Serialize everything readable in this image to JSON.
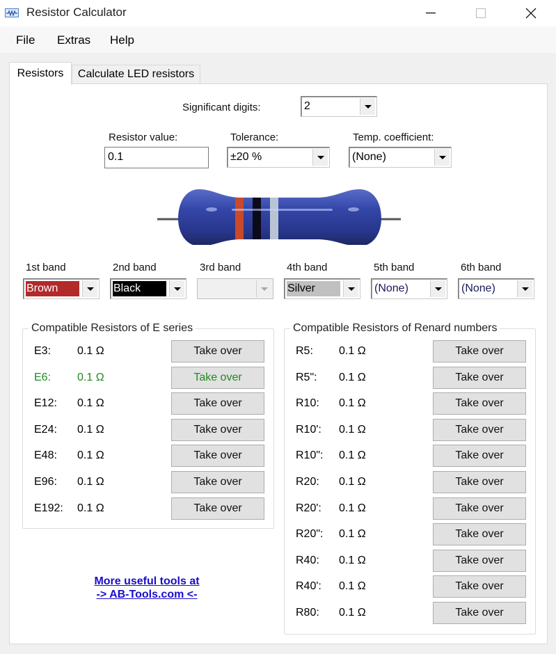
{
  "window": {
    "title": "Resistor Calculator",
    "icon": "resistor-icon",
    "controls": {
      "minimize": "minimize-icon",
      "maximize": "maximize-icon",
      "close": "close-icon"
    }
  },
  "menu": [
    "File",
    "Extras",
    "Help"
  ],
  "tabs": [
    {
      "label": "Resistors",
      "active": true
    },
    {
      "label": "Calculate LED resistors",
      "active": false
    }
  ],
  "significant_digits": {
    "label": "Significant digits:",
    "value": "2"
  },
  "resistor_value": {
    "label": "Resistor value:",
    "value": "0.1"
  },
  "tolerance": {
    "label": "Tolerance:",
    "value": "±20 %"
  },
  "temp_coefficient": {
    "label": "Temp. coefficient:",
    "value": "(None)"
  },
  "resistor_graphic": {
    "body_color": "#2e3f9a",
    "bands": [
      "#c84a2a",
      "#0a0a1a",
      "#b8c4d4"
    ]
  },
  "bands": [
    {
      "label": "1st band",
      "value": "Brown",
      "bg": "#b22a2a",
      "fg": "#ffffff",
      "enabled": true
    },
    {
      "label": "2nd band",
      "value": "Black",
      "bg": "#000000",
      "fg": "#ffffff",
      "enabled": true
    },
    {
      "label": "3rd band",
      "value": "",
      "bg": "#f0f0f0",
      "fg": "#000000",
      "enabled": false
    },
    {
      "label": "4th band",
      "value": "Silver",
      "bg": "#c0c0c0",
      "fg": "#000000",
      "enabled": true
    },
    {
      "label": "5th band",
      "value": "(None)",
      "bg": "#ffffff",
      "fg": "#1a1a5a",
      "enabled": true
    },
    {
      "label": "6th band",
      "value": "(None)",
      "bg": "#ffffff",
      "fg": "#1a1a5a",
      "enabled": true
    }
  ],
  "e_series": {
    "title": "Compatible Resistors of E series",
    "highlight_color": "#1e8a1e",
    "rows": [
      {
        "name": "E3:",
        "value": "0.1 Ω",
        "button": "Take over",
        "highlight": false
      },
      {
        "name": "E6:",
        "value": "0.1 Ω",
        "button": "Take over",
        "highlight": true
      },
      {
        "name": "E12:",
        "value": "0.1 Ω",
        "button": "Take over",
        "highlight": false
      },
      {
        "name": "E24:",
        "value": "0.1 Ω",
        "button": "Take over",
        "highlight": false
      },
      {
        "name": "E48:",
        "value": "0.1 Ω",
        "button": "Take over",
        "highlight": false
      },
      {
        "name": "E96:",
        "value": "0.1 Ω",
        "button": "Take over",
        "highlight": false
      },
      {
        "name": "E192:",
        "value": "0.1 Ω",
        "button": "Take over",
        "highlight": false
      }
    ]
  },
  "renard": {
    "title": "Compatible Resistors of Renard numbers",
    "rows": [
      {
        "name": "R5:",
        "value": "0.1 Ω",
        "button": "Take over"
      },
      {
        "name": "R5\":",
        "value": "0.1 Ω",
        "button": "Take over"
      },
      {
        "name": "R10:",
        "value": "0.1 Ω",
        "button": "Take over"
      },
      {
        "name": "R10':",
        "value": "0.1 Ω",
        "button": "Take over"
      },
      {
        "name": "R10\":",
        "value": "0.1 Ω",
        "button": "Take over"
      },
      {
        "name": "R20:",
        "value": "0.1 Ω",
        "button": "Take over"
      },
      {
        "name": "R20':",
        "value": "0.1 Ω",
        "button": "Take over"
      },
      {
        "name": "R20\":",
        "value": "0.1 Ω",
        "button": "Take over"
      },
      {
        "name": "R40:",
        "value": "0.1 Ω",
        "button": "Take over"
      },
      {
        "name": "R40':",
        "value": "0.1 Ω",
        "button": "Take over"
      },
      {
        "name": "R80:",
        "value": "0.1 Ω",
        "button": "Take over"
      }
    ]
  },
  "promo_link": {
    "line1": "More useful tools at",
    "line2": "-> AB-Tools.com <-",
    "color": "#1a0dcc"
  }
}
